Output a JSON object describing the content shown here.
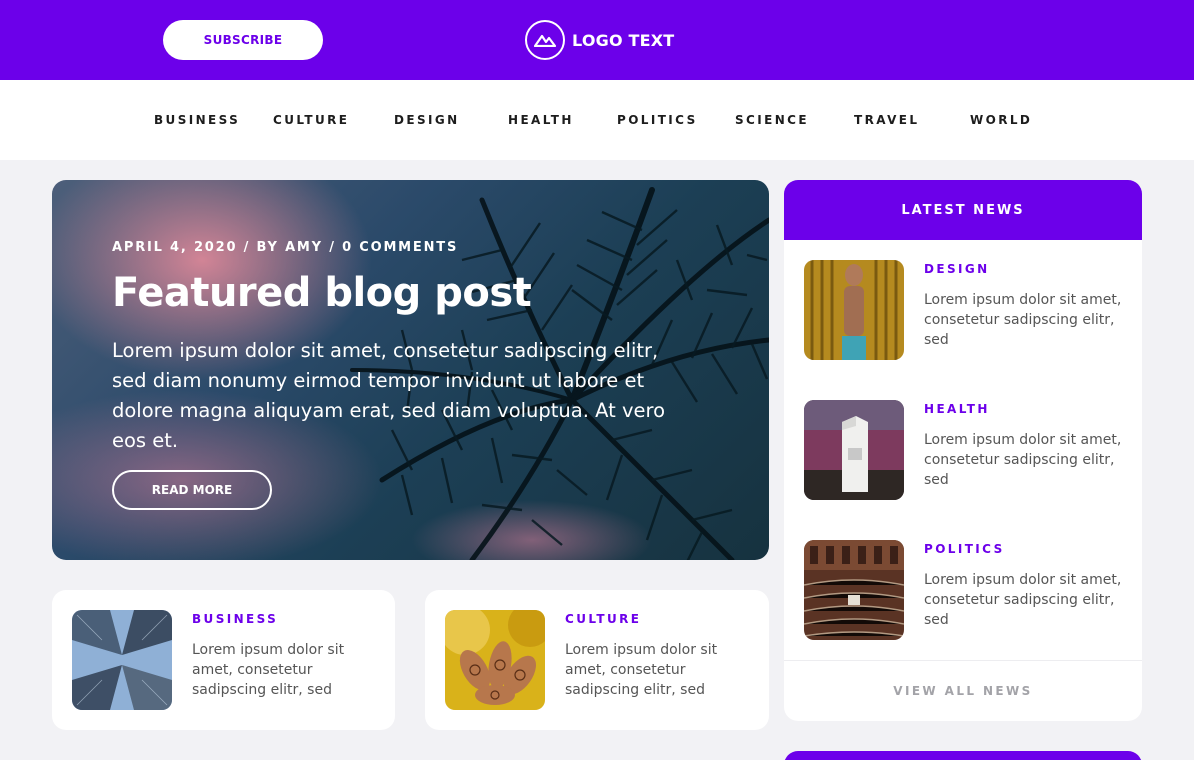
{
  "header": {
    "subscribe_label": "SUBSCRIBE",
    "logo_text": "LOGO TEXT",
    "logo_icon": "mountain-icon"
  },
  "nav": {
    "items": [
      "BUSINESS",
      "CULTURE",
      "DESIGN",
      "HEALTH",
      "POLITICS",
      "SCIENCE",
      "TRAVEL",
      "WORLD"
    ]
  },
  "featured": {
    "meta": "APRIL 4, 2020 / BY AMY / 0 COMMENTS",
    "title": "Featured blog post",
    "body": "Lorem ipsum dolor sit amet, consetetur sadipscing elitr, sed diam nonumy eirmod tempor invidunt ut labore et dolore magna aliquyam erat, sed diam voluptua. At vero eos et.",
    "button_label": "READ MORE"
  },
  "cards": [
    {
      "category": "BUSINESS",
      "excerpt": "Lorem ipsum dolor sit amet, consetetur sadipscing elitr, sed"
    },
    {
      "category": "CULTURE",
      "excerpt": "Lorem ipsum dolor sit amet, consetetur sadipscing elitr, sed"
    }
  ],
  "latest": {
    "title": "LATEST NEWS",
    "items": [
      {
        "category": "DESIGN",
        "excerpt": "Lorem ipsum dolor sit amet, consetetur sadipscing elitr, sed"
      },
      {
        "category": "HEALTH",
        "excerpt": "Lorem ipsum dolor sit amet, consetetur sadipscing elitr, sed"
      },
      {
        "category": "POLITICS",
        "excerpt": "Lorem ipsum dolor sit amet, consetetur sadipscing elitr, sed"
      }
    ],
    "view_all_label": "VIEW ALL NEWS"
  },
  "colors": {
    "accent": "#6c00ea",
    "page_background": "#f2f2f5",
    "muted_text": "#a3a3a8"
  }
}
